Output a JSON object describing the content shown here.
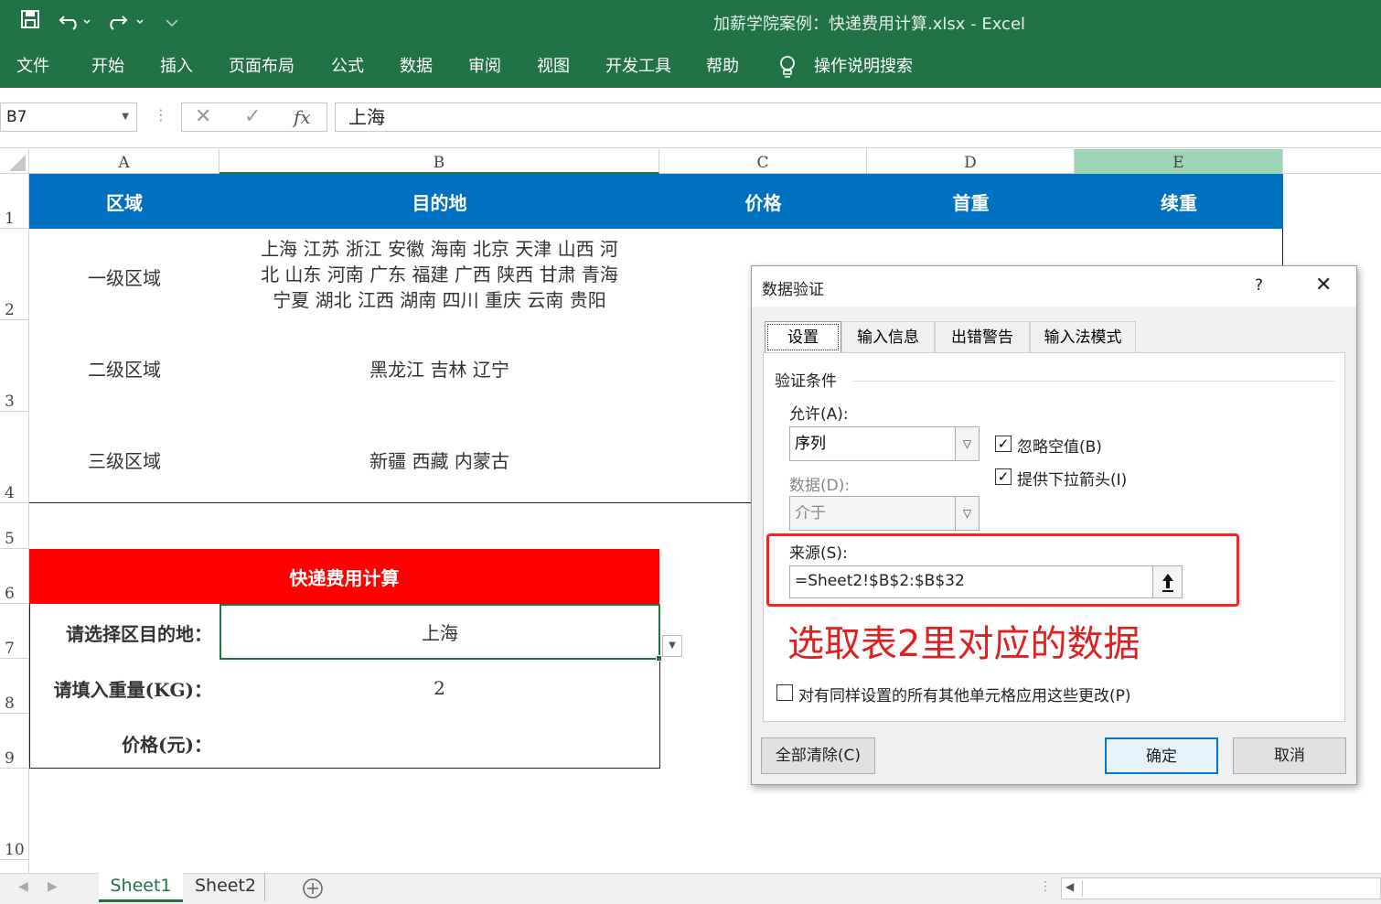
{
  "titlebar": {
    "title": "加薪学院案例：快递费用计算.xlsx  -  Excel"
  },
  "ribbon": {
    "tabs": [
      "文件",
      "开始",
      "插入",
      "页面布局",
      "公式",
      "数据",
      "审阅",
      "视图",
      "开发工具",
      "帮助"
    ],
    "search": "操作说明搜索"
  },
  "formula_bar": {
    "name_box": "B7",
    "fx": "fx",
    "formula": "上海"
  },
  "columns": [
    "A",
    "B",
    "C",
    "D",
    "E"
  ],
  "rows": [
    "1",
    "2",
    "3",
    "4",
    "5",
    "6",
    "7",
    "8",
    "9",
    "10"
  ],
  "sheet": {
    "header": {
      "a": "区域",
      "b": "目的地",
      "c": "价格",
      "d": "首重",
      "e": "续重"
    },
    "r2": {
      "a": "一级区域",
      "b1": "上海  江苏  浙江  安徽  海南  北京  天津  山西  河",
      "b2": "北  山东  河南  广东  福建  广西  陕西  甘肃  青海",
      "b3": "宁夏  湖北  江西  湖南  四川  重庆  云南  贵阳"
    },
    "r3": {
      "a": "二级区域",
      "b": "黑龙江  吉林  辽宁"
    },
    "r4": {
      "a": "三级区域",
      "b": "新疆  西藏  内蒙古"
    },
    "calc_title": "快递费用计算",
    "r7": {
      "label": "请选择区目的地：",
      "value": "上海"
    },
    "r8": {
      "label": "请填入重量(KG)：",
      "value": "2"
    },
    "r9": {
      "label": "价格(元)："
    }
  },
  "tabs": {
    "sheet1": "Sheet1",
    "sheet2": "Sheet2"
  },
  "dialog": {
    "title": "数据验证",
    "help": "?",
    "tabs": [
      "设置",
      "输入信息",
      "出错警告",
      "输入法模式"
    ],
    "group": "验证条件",
    "allow_label": "允许(A):",
    "allow_value": "序列",
    "ignore_blank": "忽略空值(B)",
    "dropdown_arrow": "提供下拉箭头(I)",
    "data_label": "数据(D):",
    "data_value": "介于",
    "source_label": "来源(S):",
    "source_value": "=Sheet2!$B$2:$B$32",
    "annotation": "选取表2里对应的数据",
    "apply_all": "对有同样设置的所有其他单元格应用这些更改(P)",
    "clear_all": "全部清除(C)",
    "ok": "确定",
    "cancel": "取消"
  },
  "colors": {
    "excel_green": "#217346",
    "header_blue": "#0070C0",
    "calc_red": "#FF0000",
    "annotation_red": "#E02020"
  }
}
